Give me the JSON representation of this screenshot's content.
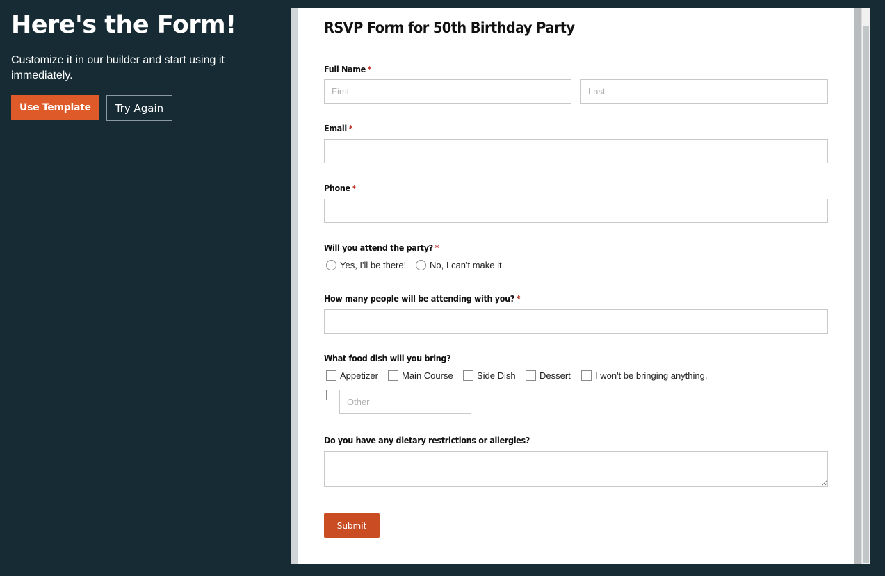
{
  "left_panel": {
    "heading": "Here's the Form!",
    "subtext": "Customize it in our builder and start using it immediately.",
    "use_template_label": "Use Template",
    "try_again_label": "Try Again"
  },
  "form": {
    "title": "RSVP Form for 50th Birthday Party",
    "required_mark": "*",
    "full_name": {
      "label": "Full Name",
      "first_placeholder": "First",
      "last_placeholder": "Last"
    },
    "email": {
      "label": "Email"
    },
    "phone": {
      "label": "Phone"
    },
    "attend": {
      "label": "Will you attend the party?",
      "options": [
        "Yes, I'll be there!",
        "No, I can't make it."
      ]
    },
    "guests": {
      "label": "How many people will be attending with you?"
    },
    "food": {
      "label": "What food dish will you bring?",
      "options": [
        "Appetizer",
        "Main Course",
        "Side Dish",
        "Dessert",
        "I won't be bringing anything."
      ],
      "other_placeholder": "Other"
    },
    "dietary": {
      "label": "Do you have any dietary restrictions or allergies?"
    },
    "submit_label": "Submit"
  },
  "colors": {
    "background": "#162b34",
    "accent": "#de5a29",
    "submit": "#c94c23",
    "required": "#c0392b"
  }
}
